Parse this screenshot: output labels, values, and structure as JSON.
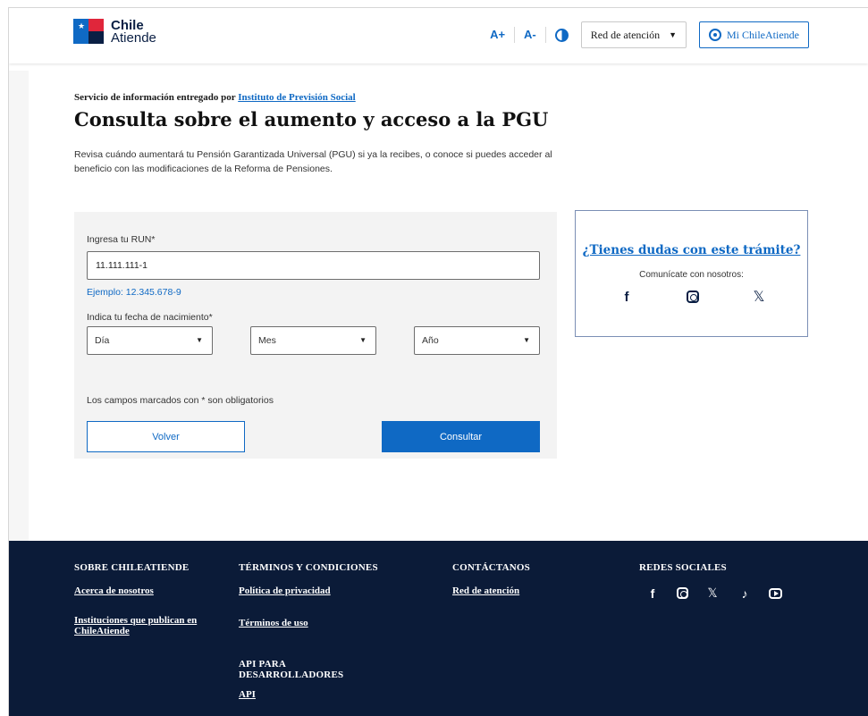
{
  "header": {
    "logo_line1": "Chile",
    "logo_line2": "Atiende",
    "font_increase": "A+",
    "font_decrease": "A-",
    "network_dropdown": "Red de atención",
    "account_button": "Mi ChileAtiende"
  },
  "intro": {
    "provider_prefix": "Servicio de información entregado por",
    "provider_link": "Instituto de Previsión Social",
    "title": "Consulta sobre el aumento y acceso a la PGU",
    "description": "Revisa cuándo aumentará tu Pensión Garantizada Universal (PGU) si ya la recibes, o conoce si puedes acceder al beneficio con las modificaciones de la Reforma de Pensiones."
  },
  "form": {
    "run_label": "Ingresa tu RUN*",
    "run_value": "11.111.111-1",
    "run_hint": "Ejemplo: 12.345.678-9",
    "birth_label": "Indica tu fecha de nacimiento*",
    "day_select": "Día",
    "month_select": "Mes",
    "year_select": "Año",
    "required_note": "Los campos marcados con * son obligatorios",
    "back_button": "Volver",
    "submit_button": "Consultar"
  },
  "help": {
    "title": "¿Tienes dudas con este trámite?",
    "subtitle": "Comunícate con nosotros:",
    "icons": [
      "facebook-icon",
      "instagram-icon",
      "x-icon"
    ]
  },
  "footer": {
    "col1_heading": "SOBRE CHILEATIENDE",
    "col1_link1": "Acerca de nosotros",
    "col1_link2_line1": "Instituciones que publican en",
    "col1_link2_line2": "ChileAtiende",
    "col2_heading": "TÉRMINOS Y CONDICIONES",
    "col2_link1": "Política de privacidad",
    "col2_link2": "Términos de uso",
    "col2_heading2_line1": "API PARA",
    "col2_heading2_line2": "DESARROLLADORES",
    "col2_link3": "API",
    "col3_heading": "CONTÁCTANOS",
    "col3_link1": "Red de atención",
    "col4_heading": "REDES SOCIALES",
    "social_icons": [
      "facebook-icon",
      "instagram-icon",
      "x-icon",
      "tiktok-icon",
      "youtube-icon"
    ]
  },
  "colors": {
    "primary": "#0f69c4",
    "footer_bg": "#0b1b38",
    "card_bg": "#f3f3f3"
  }
}
